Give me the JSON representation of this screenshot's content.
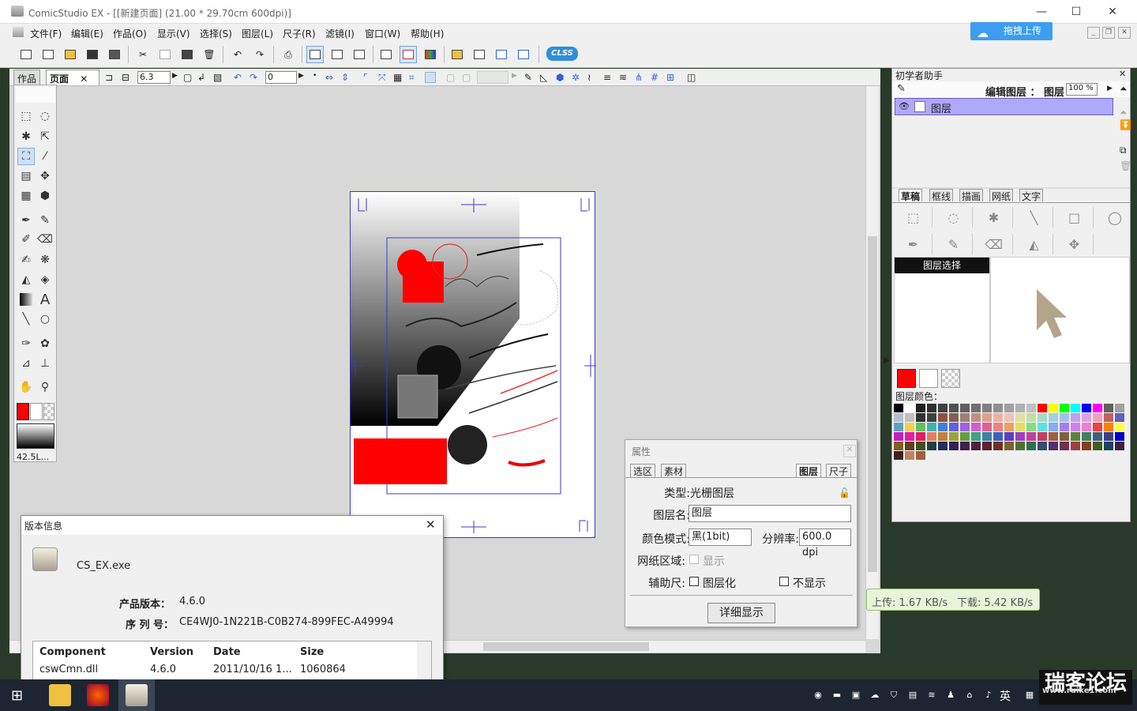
{
  "window": {
    "title": "ComicStudio EX - [[新建页面] (21.00 * 29.70cm 600dpi)]",
    "minimize": "—",
    "maximize": "☐",
    "close": "✕"
  },
  "menu": [
    "文件(F)",
    "编辑(E)",
    "作品(O)",
    "显示(V)",
    "选择(S)",
    "图层(L)",
    "尺子(R)",
    "滤镜(I)",
    "窗口(W)",
    "帮助(H)"
  ],
  "upload_button": "拖拽上传",
  "clss_badge": "CLSS",
  "doc_tabs": {
    "works": "作品",
    "page": "页面"
  },
  "toolbar2": {
    "stroke_width": "6.3",
    "angle": "0"
  },
  "toolbox": {
    "brush_size": "42.5L..."
  },
  "colors": {
    "main": "#ff0000",
    "accent_blue": "#3d9df0",
    "layer_selected": "#b0a8f8",
    "paper_border": "#3a3ad0"
  },
  "right_panel": {
    "title": "初学者助手",
    "edit_layer_label": "编辑图层 ：",
    "layer_label": "图层",
    "opacity": "100 %",
    "layer_name": "图层",
    "tabs": [
      "草稿",
      "框线",
      "描画",
      "网纸",
      "文字"
    ],
    "layer_select_label": "图层选择",
    "layer_color_label": "图层颜色："
  },
  "palette": [
    [
      "#000000",
      "#ffffff",
      "#202020",
      "#303030",
      "#404040",
      "#505050",
      "#606060",
      "#707070",
      "#808080",
      "#909090",
      "#a0a0a0",
      "#b0b0b0",
      "#c0c0c0",
      "#ff0000",
      "#ffff00",
      "#00ff00",
      "#00ffff",
      "#0000ff",
      "#ff00ff",
      "#606060",
      "#a0a0a0"
    ],
    [
      "#b0c0d0",
      "#c0c0c0",
      "#303030",
      "#404040",
      "#905040",
      "#806050",
      "#a08070",
      "#c09080",
      "#e0a090",
      "#f0b0a0",
      "#f0c0c0",
      "#e0e0a0",
      "#c0e0a0",
      "#a0e0c0",
      "#a0d0e0",
      "#a0c0f0",
      "#c0a0f0",
      "#e0a0e0",
      "#f0a0c0",
      "#c06060",
      "#6060c0"
    ],
    [
      "#60a0c0",
      "#f0d050",
      "#60c060",
      "#40b0b0",
      "#4080d0",
      "#6060e0",
      "#a060e0",
      "#d060d0",
      "#e06090",
      "#f08080",
      "#f0a060",
      "#e0e060",
      "#80e080",
      "#60e0e0",
      "#80b0f0",
      "#a080f0",
      "#d080f0",
      "#f080d0",
      "#f04040",
      "#ff8000",
      "#ffff40"
    ],
    [
      "#c020c0",
      "#e020a0",
      "#e02060",
      "#e08060",
      "#c08040",
      "#a0a040",
      "#60a040",
      "#40a080",
      "#4080a0",
      "#4060c0",
      "#6040c0",
      "#a040c0",
      "#c040a0",
      "#c04060",
      "#a06040",
      "#806040",
      "#608040",
      "#408060",
      "#406080",
      "#404080",
      "#0000c0"
    ],
    [
      "#806020",
      "#604020",
      "#405020",
      "#204040",
      "#203060",
      "#302060",
      "#402050",
      "#502040",
      "#602030",
      "#703020",
      "#806030",
      "#507030",
      "#307050",
      "#305070",
      "#503070",
      "#703050",
      "#a04040",
      "#804020",
      "#406020",
      "#204060",
      "#402040"
    ],
    [
      "#402020",
      "#c08060",
      "#a06040"
    ]
  ],
  "props": {
    "title": "属性",
    "tabs_left": [
      "选区",
      "素材"
    ],
    "tabs_right": [
      "图层",
      "尺子"
    ],
    "type_label": "类型:",
    "type_value": "光栅图层",
    "name_label": "图层名:",
    "name_value": "图层",
    "color_mode_label": "颜色模式:",
    "color_mode_value": "黑(1bit)",
    "resolution_label": "分辨率:",
    "resolution_value": "600.0 dpi",
    "tone_label": "网纸区域:",
    "tone_check": "显示",
    "ruler_label": "辅助尺:",
    "ruler_check": "图层化",
    "hide_check": "不显示",
    "detail_button": "详细显示"
  },
  "about": {
    "title": "版本信息",
    "exe": "CS_EX.exe",
    "version_label": "产品版本：",
    "version_value": "4.6.0",
    "serial_label": "序 列 号：",
    "serial_value": "CE4WJ0-1N221B-C0B274-899FEC-A49994",
    "columns": [
      "Component",
      "Version",
      "Date",
      "Size"
    ],
    "row": [
      "cswCmn.dll",
      "4.6.0",
      "2011/10/16 1...",
      "1060864"
    ]
  },
  "speed": {
    "upload": "上传: 1.67 KB/s",
    "download": "下载: 5.42 KB/s"
  },
  "taskbar": {
    "ime": "英",
    "watermark": "瑞客论坛",
    "watermark_url": "www.ruike1.com"
  }
}
